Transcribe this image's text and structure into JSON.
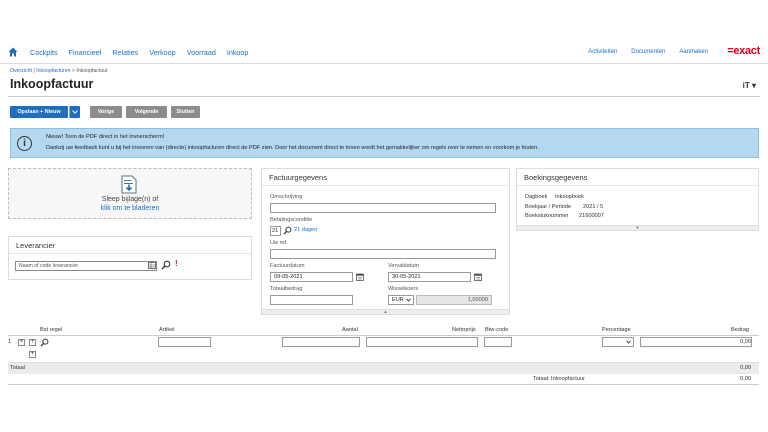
{
  "nav": {
    "items": [
      "Cockpits",
      "Financieel",
      "Relaties",
      "Verkoop",
      "Voorraad",
      "Inkoop"
    ],
    "right_items": [
      "Activiteiten",
      "Documenten",
      "Aanmaken"
    ],
    "logo": "=exact"
  },
  "breadcrumb": {
    "link1": "Overzicht",
    "sep1": " | ",
    "link2": "Inkoopfacturen",
    "sep2": " > ",
    "current": "Inkoopfactuur"
  },
  "page": {
    "title": "Inkoopfactuur",
    "user_menu": "iT ▾"
  },
  "toolbar": {
    "save_new": "Opslaan + Nieuw",
    "prev": "Vorige",
    "next": "Volgende",
    "close": "Sluiten"
  },
  "info": {
    "line1": "Nieuw! Toon de PDF direct in het invoerscherm!",
    "line2": "Dankzij uw feedback kunt u bij het invoeren van (directe) inkoopfacturen direct de PDF zien. Door het document direct te tonen wordt het gemakkelijker om regels over te nemen en voorkom je fouten."
  },
  "dropzone": {
    "line1": "Sleep bijlage(n) of",
    "line2": "klik om te bladeren"
  },
  "leverancier": {
    "title": "Leverancier",
    "placeholder": "Naam of code leverancier",
    "required_mark": "!"
  },
  "factuur": {
    "title": "Factuurgegevens",
    "omschrijving_label": "Omschrijving",
    "omschrijving_value": "",
    "betalingsconditie_label": "Betalingsconditie",
    "betalingsconditie_code": "21",
    "betalingsconditie_text": "21 dagen",
    "uwref_label": "Uw ref.",
    "uwref_value": "",
    "factuurdatum_label": "Factuurdatum",
    "factuurdatum_value": "09-05-2021",
    "vervaldatum_label": "Vervaldatum",
    "vervaldatum_value": "30-05-2021",
    "totaalbedrag_label": "Totaalbedrag",
    "totaalbedrag_value": "",
    "wisselkoers_label": "Wisselkoers",
    "currency": "EUR",
    "rate": "1,00000"
  },
  "boeking": {
    "title": "Boekingsgegevens",
    "rows": [
      {
        "label": "Dagboek",
        "value": "Inkoopboek"
      },
      {
        "label": "Boekjaar / Periode",
        "value": "2021 / 5"
      },
      {
        "label": "Boekstuknummer",
        "value": "21600007"
      }
    ]
  },
  "grid": {
    "headers": {
      "bst_regel": "Bst regel",
      "artikel": "Artikel",
      "aantal": "Aantal",
      "nettoprijs": "Nettoprijs",
      "btw_code": "Btw-code",
      "percentage": "Percentage",
      "bedrag": "Bedrag"
    },
    "row_number": "1",
    "row_amount": "0,00"
  },
  "totals": {
    "totaal_label": "Totaal",
    "totaal_value": "0,00",
    "inkoopfactuur_label": "Totaal: Inkoopfactuur",
    "inkoopfactuur_value": "0,00"
  },
  "colors": {
    "brand": "#e1001a",
    "primary": "#1f6dbf",
    "link": "#1a6fc6",
    "info_bg": "#b4d8ef"
  }
}
